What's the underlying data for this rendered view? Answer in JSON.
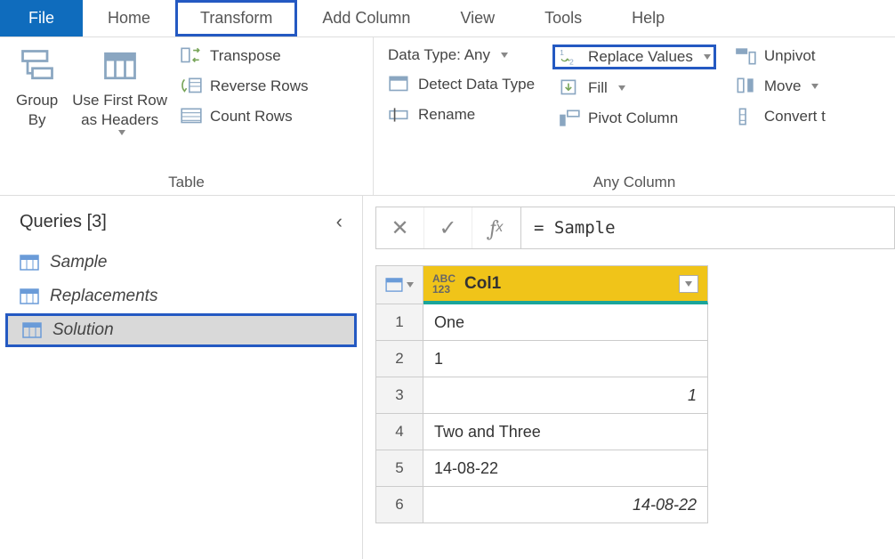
{
  "tabs": {
    "file": "File",
    "items": [
      "Home",
      "Transform",
      "Add Column",
      "View",
      "Tools",
      "Help"
    ],
    "highlighted_index": 1
  },
  "ribbon": {
    "table_group": {
      "label": "Table",
      "group_by": "Group\nBy",
      "use_first_row": "Use First Row\nas Headers",
      "transpose": "Transpose",
      "reverse_rows": "Reverse Rows",
      "count_rows": "Count Rows"
    },
    "anycol_group": {
      "label": "Any Column",
      "data_type": "Data Type: Any",
      "detect": "Detect Data Type",
      "rename": "Rename",
      "replace_values": "Replace Values",
      "fill": "Fill",
      "pivot": "Pivot Column",
      "unpivot": "Unpivot",
      "move": "Move",
      "convert": "Convert t"
    }
  },
  "queries": {
    "title": "Queries [3]",
    "items": [
      "Sample",
      "Replacements",
      "Solution"
    ],
    "highlighted_index": 2
  },
  "formula": "= Sample",
  "grid": {
    "column_name": "Col1",
    "type_label": "ABC\n123",
    "rows": [
      {
        "n": "1",
        "v": "One",
        "italic": false
      },
      {
        "n": "2",
        "v": "1",
        "italic": false
      },
      {
        "n": "3",
        "v": "1",
        "italic": true
      },
      {
        "n": "4",
        "v": "Two and Three",
        "italic": false
      },
      {
        "n": "5",
        "v": "14-08-22",
        "italic": false
      },
      {
        "n": "6",
        "v": "14-08-22",
        "italic": true
      }
    ]
  }
}
